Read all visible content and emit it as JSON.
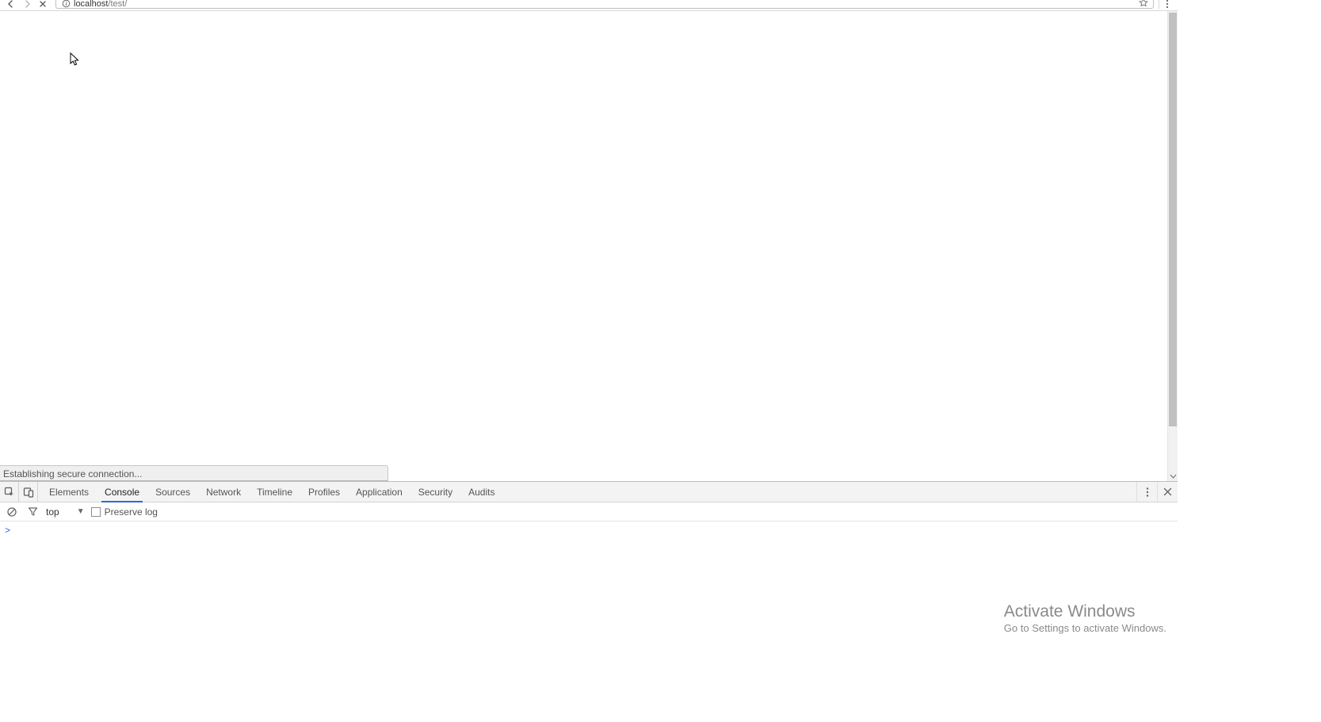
{
  "address_bar": {
    "host": "localhost",
    "path": "/test/"
  },
  "status_bar": {
    "text": "Establishing secure connection..."
  },
  "devtools": {
    "tabs": [
      {
        "id": "elements",
        "label": "Elements"
      },
      {
        "id": "console",
        "label": "Console"
      },
      {
        "id": "sources",
        "label": "Sources"
      },
      {
        "id": "network",
        "label": "Network"
      },
      {
        "id": "timeline",
        "label": "Timeline"
      },
      {
        "id": "profiles",
        "label": "Profiles"
      },
      {
        "id": "application",
        "label": "Application"
      },
      {
        "id": "security",
        "label": "Security"
      },
      {
        "id": "audits",
        "label": "Audits"
      }
    ],
    "active_tab": "console",
    "console_toolbar": {
      "context": "top",
      "preserve_log_label": "Preserve log",
      "preserve_log_checked": false
    },
    "console_prompt": ">"
  },
  "watermark": {
    "title": "Activate Windows",
    "subtitle": "Go to Settings to activate Windows."
  },
  "icons": {
    "back": "back-icon",
    "forward": "forward-icon",
    "stop": "stop-icon",
    "info": "info-icon",
    "star": "star-icon",
    "chrome_menu": "kebab-icon",
    "inspect": "inspect-icon",
    "device": "device-toggle-icon",
    "clear": "clear-console-icon",
    "filter": "filter-icon",
    "dt_menu": "kebab-icon",
    "dt_close": "close-icon"
  }
}
